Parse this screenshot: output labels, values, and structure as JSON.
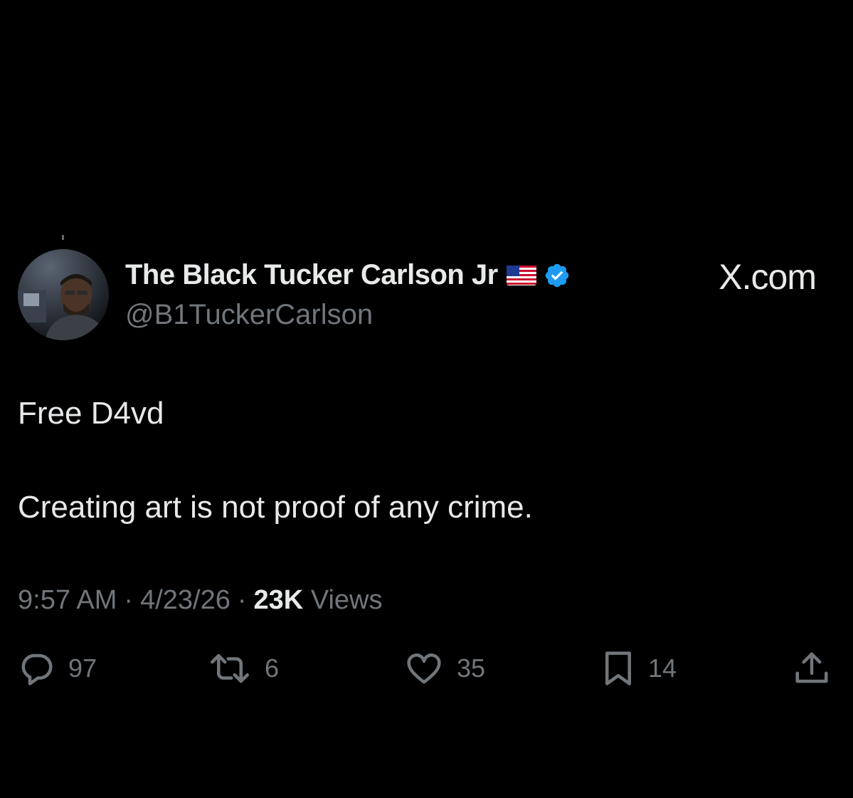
{
  "author": {
    "display_name": "The Black Tucker Carlson Jr",
    "handle": "@B1TuckerCarlson",
    "flag": "🇺🇸",
    "verified": true,
    "verified_color": "#1d9bf0"
  },
  "site_mark": "X.com",
  "tweet": {
    "lines": [
      "Free D4vd",
      "Creating art is not proof of any crime."
    ]
  },
  "meta": {
    "time": "9:57 AM",
    "separator": "·",
    "date": "4/23/26",
    "views_count": "23K",
    "views_label": "Views"
  },
  "actions": {
    "reply": {
      "icon": "reply-icon",
      "count": "97"
    },
    "repost": {
      "icon": "repost-icon",
      "count": "6"
    },
    "like": {
      "icon": "heart-icon",
      "count": "35"
    },
    "bookmark": {
      "icon": "bookmark-icon",
      "count": "14"
    },
    "share": {
      "icon": "share-icon"
    }
  },
  "colors": {
    "background": "#000000",
    "primary_text": "#e7e9ea",
    "secondary_text": "#71767b"
  }
}
